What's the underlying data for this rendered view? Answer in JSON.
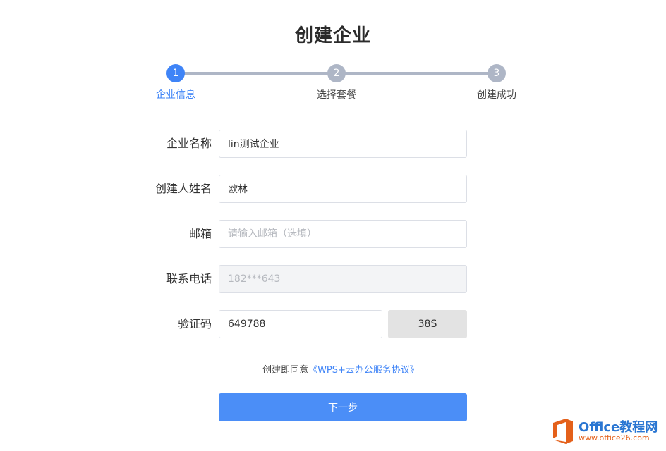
{
  "page": {
    "title": "创建企业"
  },
  "stepper": {
    "steps": [
      {
        "number": "1",
        "label": "企业信息",
        "active": true
      },
      {
        "number": "2",
        "label": "选择套餐",
        "active": false
      },
      {
        "number": "3",
        "label": "创建成功",
        "active": false
      }
    ]
  },
  "form": {
    "company_name": {
      "label": "企业名称",
      "value": "lin测试企业"
    },
    "creator_name": {
      "label": "创建人姓名",
      "value": "欧林"
    },
    "email": {
      "label": "邮箱",
      "value": "",
      "placeholder": "请输入邮箱（选填）"
    },
    "phone": {
      "label": "联系电话",
      "value": "",
      "placeholder": "182***643"
    },
    "verification": {
      "label": "验证码",
      "value": "649788",
      "countdown": "38S"
    }
  },
  "agreement": {
    "prefix": "创建即同意",
    "link": "《WPS+云办公服务协议》"
  },
  "actions": {
    "next_label": "下一步"
  },
  "watermark": {
    "main": "Office教程网",
    "sub": "www.office26.com"
  },
  "colors": {
    "accent": "#3f84f7",
    "step_inactive": "#aeb6c6",
    "watermark_orange": "#e4601a"
  }
}
